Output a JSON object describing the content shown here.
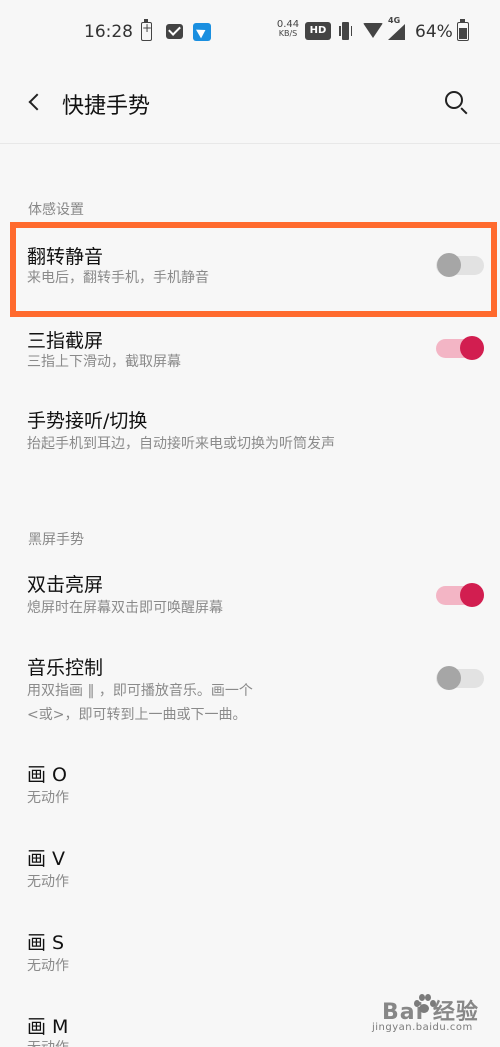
{
  "status_bar": {
    "time": "16:28",
    "net_speed_value": "0.44",
    "net_speed_unit": "KB/S",
    "hd_label": "HD",
    "network_type": "4G",
    "battery_percent": "64%",
    "battery_level": 0.64,
    "icons": [
      "battery-charging-icon",
      "mail-icon",
      "app-notification-icon",
      "vibrate-icon",
      "wifi-icon",
      "signal-icon",
      "battery-icon"
    ]
  },
  "header": {
    "back_icon": "chevron-left-icon",
    "title": "快捷手势",
    "search_icon": "search-icon"
  },
  "sections": [
    {
      "title": "体感设置",
      "items": [
        {
          "title": "翻转静音",
          "subtitle": "来电后，翻转手机，手机静音",
          "toggle": "off"
        },
        {
          "title": "三指截屏",
          "subtitle": "三指上下滑动，截取屏幕",
          "toggle": "on"
        },
        {
          "title": "手势接听/切换",
          "subtitle": "抬起手机到耳边，自动接听来电或切换为听筒发声",
          "toggle": null
        }
      ]
    },
    {
      "title": "黑屏手势",
      "items": [
        {
          "title": "双击亮屏",
          "subtitle": "熄屏时在屏幕双击即可唤醒屏幕",
          "toggle": "on"
        },
        {
          "title": "音乐控制",
          "subtitle_lines": [
            "用双指画 ‖ ，即可播放音乐。画一个",
            "<或>，即可转到上一曲或下一曲。"
          ],
          "toggle": "off"
        },
        {
          "title": "画 O",
          "subtitle": "无动作",
          "toggle": null
        },
        {
          "title": "画 V",
          "subtitle": "无动作",
          "toggle": null
        },
        {
          "title": "画 S",
          "subtitle": "无动作",
          "toggle": null
        },
        {
          "title": "画 M",
          "subtitle": "无动作",
          "toggle": null
        }
      ]
    }
  ],
  "watermark": {
    "brand": "Bai  经验",
    "url": "jingyan.baidu.com"
  },
  "colors": {
    "highlight_border": "#ff6a2e",
    "toggle_on": "#d21e50",
    "toggle_off": "#a6a6a6"
  }
}
